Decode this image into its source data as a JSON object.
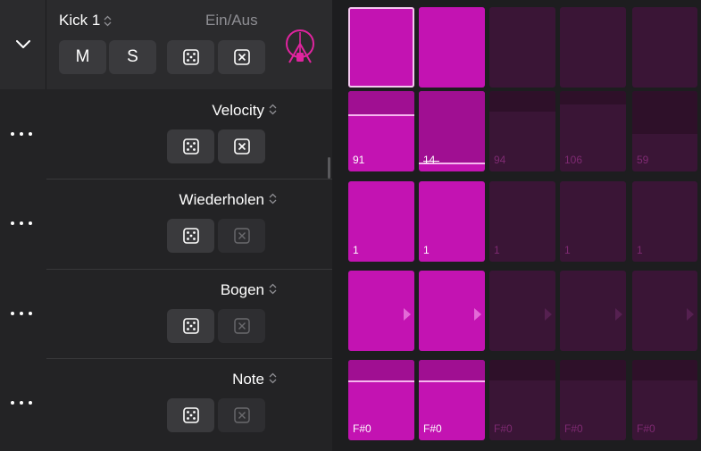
{
  "header": {
    "track_name": "Kick 1",
    "onoff_label": "Ein/Aus",
    "mute_label": "M",
    "solo_label": "S"
  },
  "rows": [
    {
      "label": "Velocity"
    },
    {
      "label": "Wiederholen"
    },
    {
      "label": "Bogen"
    },
    {
      "label": "Note"
    }
  ],
  "colors": {
    "accent": "#c313b2",
    "inactive": "#3a1536",
    "drum_icon": "#e0249f"
  },
  "grid": {
    "main": [
      true,
      true,
      false,
      false,
      false
    ],
    "velocity": [
      91,
      14,
      94,
      106,
      59
    ],
    "repeat": [
      "1",
      "1",
      "1",
      "1",
      "1"
    ],
    "note": [
      "F#0",
      "F#0",
      "F#0",
      "F#0",
      "F#0"
    ],
    "active_steps": 2
  }
}
